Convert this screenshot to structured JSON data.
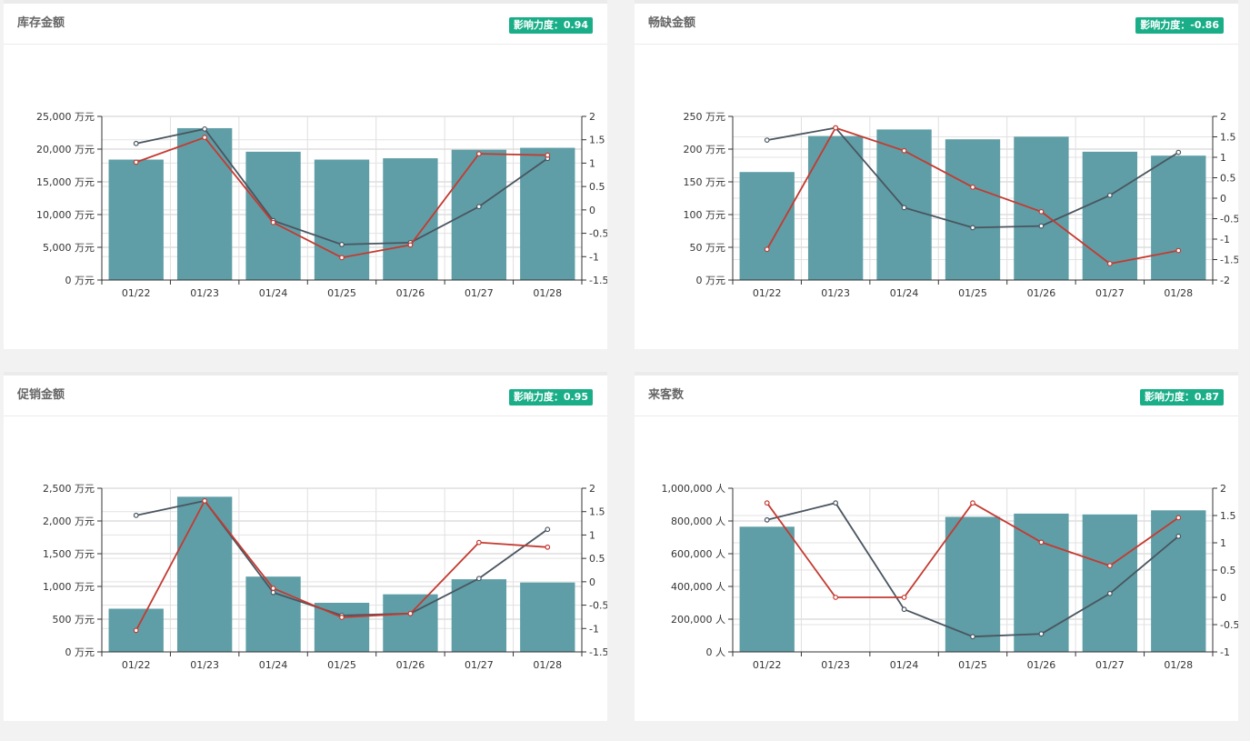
{
  "panels": [
    {
      "title": "库存金额",
      "impact_label": "影响力度：",
      "impact_value": "0.94",
      "chart_data": {
        "type": "bar",
        "categories": [
          "01/22",
          "01/23",
          "01/24",
          "01/25",
          "01/26",
          "01/27",
          "01/28"
        ],
        "left_axis": {
          "min": 0,
          "max": 25000,
          "step": 5000,
          "tick_labels": [
            "0 万元",
            "5,000 万元",
            "10,000 万元",
            "15,000 万元",
            "20,000 万元",
            "25,000 万元"
          ]
        },
        "right_axis": {
          "min": -1.5,
          "max": 2,
          "step": 0.5,
          "tick_labels": [
            "-1.5",
            "-1",
            "-0.5",
            "0",
            "0.5",
            "1",
            "1.5",
            "2"
          ]
        },
        "bars": [
          18400,
          23200,
          19600,
          18400,
          18600,
          19900,
          20200
        ],
        "series": [
          {
            "color": "#4a5560",
            "values": [
              1.42,
              1.73,
              -0.23,
              -0.74,
              -0.7,
              0.07,
              1.1
            ]
          },
          {
            "color": "#c43a31",
            "values": [
              1.02,
              1.55,
              -0.27,
              -1.02,
              -0.75,
              1.2,
              1.17
            ]
          }
        ],
        "bar_color": "#5f9ea6",
        "grid": true
      }
    },
    {
      "title": "畅缺金额",
      "impact_label": "影响力度：",
      "impact_value": "-0.86",
      "chart_data": {
        "type": "bar",
        "categories": [
          "01/22",
          "01/23",
          "01/24",
          "01/25",
          "01/26",
          "01/27",
          "01/28"
        ],
        "left_axis": {
          "min": 0,
          "max": 250,
          "step": 50,
          "tick_labels": [
            "0 万元",
            "50 万元",
            "100 万元",
            "150 万元",
            "200 万元",
            "250 万元"
          ]
        },
        "right_axis": {
          "min": -2,
          "max": 2,
          "step": 0.5,
          "tick_labels": [
            "-2",
            "-1.5",
            "-1",
            "-0.5",
            "0",
            "0.5",
            "1",
            "1.5",
            "2"
          ]
        },
        "bars": [
          165,
          220,
          230,
          215,
          219,
          196,
          190
        ],
        "series": [
          {
            "color": "#4a5560",
            "values": [
              1.42,
              1.72,
              -0.23,
              -0.72,
              -0.68,
              0.07,
              1.12
            ]
          },
          {
            "color": "#c43a31",
            "values": [
              -1.25,
              1.72,
              1.16,
              0.27,
              -0.33,
              -1.6,
              -1.28
            ]
          }
        ],
        "bar_color": "#5f9ea6",
        "grid": true
      }
    },
    {
      "title": "促销金额",
      "impact_label": "影响力度：",
      "impact_value": "0.95",
      "chart_data": {
        "type": "bar",
        "categories": [
          "01/22",
          "01/23",
          "01/24",
          "01/25",
          "01/26",
          "01/27",
          "01/28"
        ],
        "left_axis": {
          "min": 0,
          "max": 2500,
          "step": 500,
          "tick_labels": [
            "0 万元",
            "500 万元",
            "1,000 万元",
            "1,500 万元",
            "2,000 万元",
            "2,500 万元"
          ]
        },
        "right_axis": {
          "min": -1.5,
          "max": 2,
          "step": 0.5,
          "tick_labels": [
            "-1.5",
            "-1",
            "-0.5",
            "0",
            "0.5",
            "1",
            "1.5",
            "2"
          ]
        },
        "bars": [
          660,
          2370,
          1150,
          750,
          880,
          1110,
          1060
        ],
        "series": [
          {
            "color": "#4a5560",
            "values": [
              1.42,
              1.73,
              -0.23,
              -0.72,
              -0.68,
              0.07,
              1.12
            ]
          },
          {
            "color": "#c43a31",
            "values": [
              -1.04,
              1.73,
              -0.14,
              -0.76,
              -0.68,
              0.84,
              0.74
            ]
          }
        ],
        "bar_color": "#5f9ea6",
        "grid": true
      }
    },
    {
      "title": "来客数",
      "impact_label": "影响力度：",
      "impact_value": "0.87",
      "chart_data": {
        "type": "bar",
        "categories": [
          "01/22",
          "01/23",
          "01/24",
          "01/25",
          "01/26",
          "01/27",
          "01/28"
        ],
        "left_axis": {
          "min": 0,
          "max": 1000000,
          "step": 200000,
          "tick_labels": [
            "0 人",
            "200,000 人",
            "400,000 人",
            "600,000 人",
            "800,000 人",
            "1,000,000 人"
          ]
        },
        "right_axis": {
          "min": -1,
          "max": 2,
          "step": 0.5,
          "tick_labels": [
            "-1",
            "-0.5",
            "0",
            "0.5",
            "1",
            "1.5",
            "2"
          ]
        },
        "bars": [
          765000,
          0,
          0,
          825000,
          845000,
          840000,
          865000
        ],
        "series": [
          {
            "color": "#4a5560",
            "values": [
              1.42,
              1.73,
              -0.22,
              -0.72,
              -0.67,
              0.07,
              1.12
            ]
          },
          {
            "color": "#c43a31",
            "values": [
              1.73,
              0.0,
              0.0,
              1.73,
              1.01,
              0.58,
              1.46
            ]
          }
        ],
        "bar_color": "#5f9ea6",
        "grid": true
      }
    }
  ]
}
